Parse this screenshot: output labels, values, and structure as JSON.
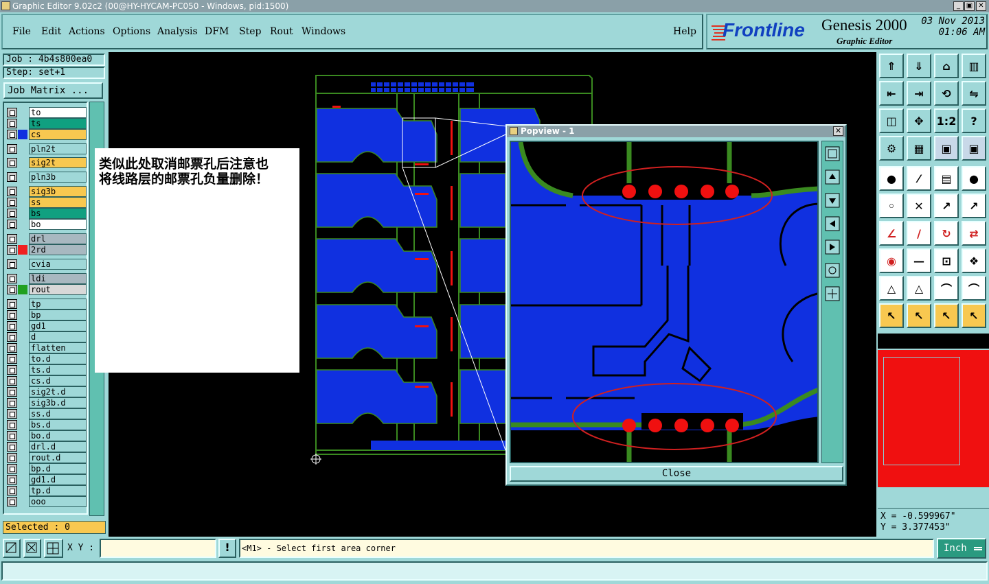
{
  "window": {
    "title": "Graphic Editor 9.02c2 (00@HY-HYCAM-PC050 - Windows, pid:1500)",
    "controls": [
      "_",
      "▣",
      "✕"
    ]
  },
  "menu": {
    "items": [
      "File",
      "Edit",
      "Actions",
      "Options",
      "Analysis",
      "DFM",
      "Step",
      "Rout",
      "Windows"
    ],
    "help": "Help"
  },
  "brand": {
    "logo": "Frontline",
    "product": "Genesis 2000",
    "subtitle": "Graphic Editor",
    "date": "03 Nov 2013",
    "time": "01:06 AM"
  },
  "job": {
    "job_label": "Job : 4b4s800ea0",
    "step_label": "Step: set+1",
    "matrix_button": "Job Matrix ..."
  },
  "layers": [
    {
      "name": "to",
      "bg": "#ffffff",
      "color": ""
    },
    {
      "name": "ts",
      "bg": "#10a080",
      "color": ""
    },
    {
      "name": "cs",
      "bg": "#f8c850",
      "color": "#1030e0"
    },
    {
      "name": "pln2t",
      "bg": "#9fd8d8",
      "color": ""
    },
    {
      "name": "sig2t",
      "bg": "#f8c850",
      "color": ""
    },
    {
      "name": "pln3b",
      "bg": "#9fd8d8",
      "color": ""
    },
    {
      "name": "sig3b",
      "bg": "#f8c850",
      "color": ""
    },
    {
      "name": "ss",
      "bg": "#f8c850",
      "color": ""
    },
    {
      "name": "bs",
      "bg": "#10a080",
      "color": ""
    },
    {
      "name": "bo",
      "bg": "#ffffff",
      "color": ""
    },
    {
      "name": "drl",
      "bg": "#a8b8c0",
      "color": ""
    },
    {
      "name": "2rd",
      "bg": "#a8b8c0",
      "color": "#f02020"
    },
    {
      "name": "cvia",
      "bg": "#9fd8d8",
      "color": ""
    },
    {
      "name": "ldi",
      "bg": "#a8b8c0",
      "color": ""
    },
    {
      "name": "rout",
      "bg": "#d8d8d8",
      "color": "#20a020"
    },
    {
      "name": "tp",
      "bg": "#9fd8d8",
      "color": ""
    },
    {
      "name": "bp",
      "bg": "#9fd8d8",
      "color": ""
    },
    {
      "name": "gd1",
      "bg": "#9fd8d8",
      "color": ""
    },
    {
      "name": "d",
      "bg": "#9fd8d8",
      "color": ""
    },
    {
      "name": "flatten",
      "bg": "#9fd8d8",
      "color": ""
    },
    {
      "name": "to.d",
      "bg": "#9fd8d8",
      "color": ""
    },
    {
      "name": "ts.d",
      "bg": "#9fd8d8",
      "color": ""
    },
    {
      "name": "cs.d",
      "bg": "#9fd8d8",
      "color": ""
    },
    {
      "name": "sig2t.d",
      "bg": "#9fd8d8",
      "color": ""
    },
    {
      "name": "sig3b.d",
      "bg": "#9fd8d8",
      "color": ""
    },
    {
      "name": "ss.d",
      "bg": "#9fd8d8",
      "color": ""
    },
    {
      "name": "bs.d",
      "bg": "#9fd8d8",
      "color": ""
    },
    {
      "name": "bo.d",
      "bg": "#9fd8d8",
      "color": ""
    },
    {
      "name": "drl.d",
      "bg": "#9fd8d8",
      "color": ""
    },
    {
      "name": "rout.d",
      "bg": "#9fd8d8",
      "color": ""
    },
    {
      "name": "bp.d",
      "bg": "#9fd8d8",
      "color": ""
    },
    {
      "name": "gd1.d",
      "bg": "#9fd8d8",
      "color": ""
    },
    {
      "name": "tp.d",
      "bg": "#9fd8d8",
      "color": ""
    },
    {
      "name": "ooo",
      "bg": "#9fd8d8",
      "color": ""
    }
  ],
  "selected": "Selected : 0",
  "note": {
    "line1": "类似此处取消邮票孔后注意也",
    "line2": "将线路层的邮票孔负量删除！"
  },
  "popview": {
    "title": "Popview - 1",
    "close_button": "Close"
  },
  "coords": {
    "x": "X = -0.599967\"",
    "y": "Y = 3.377453\""
  },
  "status": {
    "xy_label": "X Y :",
    "xy_value": "",
    "warn": "!",
    "message": "<M1> - Select first area corner",
    "units": "Inch"
  },
  "colors": {
    "panel": "#9fd8d8",
    "copper": "#1030e0",
    "rout": "#3a8a20",
    "pad": "#f01010",
    "highlight_ellipse": "#d02020"
  }
}
